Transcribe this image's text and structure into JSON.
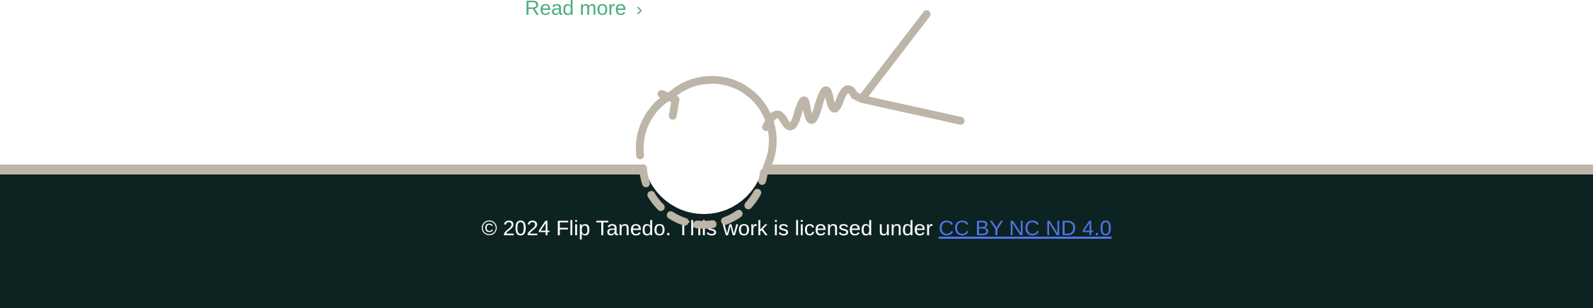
{
  "article": {
    "read_more_label": "Read more",
    "read_more_chevron": "›"
  },
  "footer": {
    "copyright_text": "© 2024 Flip Tanedo. This work is licensed under ",
    "license_link_label": "CC BY NC ND 4.0"
  },
  "colors": {
    "link_green": "#4fae7d",
    "divider": "#bdb5a8",
    "footer_bg": "#0d2322",
    "diagram_stroke": "#bdb5a8",
    "license_link": "#4f74e6"
  },
  "icons": {
    "chevron": "chevron-right-icon",
    "logo": "feynman-diagram-logo"
  }
}
